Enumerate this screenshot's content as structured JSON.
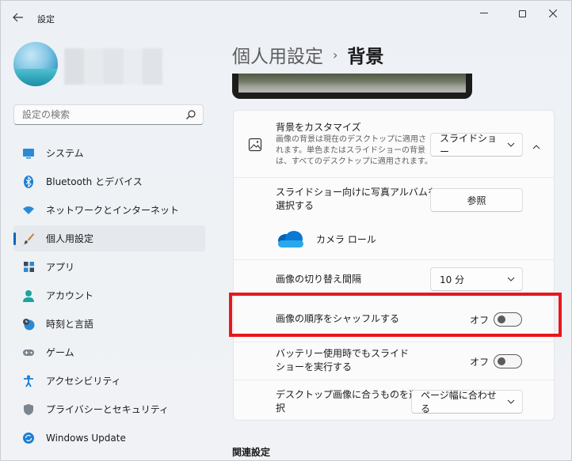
{
  "window": {
    "title": "設定",
    "controls": {
      "minimize": "—",
      "maximize": "",
      "close": "✕"
    }
  },
  "sidebar": {
    "search": {
      "placeholder": "設定の検索"
    },
    "items": [
      {
        "label": "システム",
        "icon": "monitor-icon",
        "active": false
      },
      {
        "label": "Bluetooth とデバイス",
        "icon": "bluetooth-icon",
        "active": false
      },
      {
        "label": "ネットワークとインターネット",
        "icon": "wifi-icon",
        "active": false
      },
      {
        "label": "個人用設定",
        "icon": "brush-icon",
        "active": true
      },
      {
        "label": "アプリ",
        "icon": "apps-icon",
        "active": false
      },
      {
        "label": "アカウント",
        "icon": "person-icon",
        "active": false
      },
      {
        "label": "時刻と言語",
        "icon": "clock-globe-icon",
        "active": false
      },
      {
        "label": "ゲーム",
        "icon": "gamepad-icon",
        "active": false
      },
      {
        "label": "アクセシビリティ",
        "icon": "accessibility-icon",
        "active": false
      },
      {
        "label": "プライバシーとセキュリティ",
        "icon": "shield-icon",
        "active": false
      },
      {
        "label": "Windows Update",
        "icon": "update-icon",
        "active": false
      }
    ]
  },
  "main": {
    "breadcrumb": {
      "parent": "個人用設定",
      "separator": "›",
      "current": "背景"
    },
    "customize": {
      "title": "背景をカスタマイズ",
      "description_line1": "画像の背景は現在のデスクトップに適用さ",
      "description_line2": "れます。単色またはスライドショーの背景",
      "description_line3": "は、すべてのデスクトップに適用されます。",
      "value": "スライドショー"
    },
    "album": {
      "title_line1": "スライドショー向けに写真アルバムを",
      "title_line2": "選択する",
      "button": "参照",
      "folder": "カメラ ロール"
    },
    "interval": {
      "title": "画像の切り替え間隔",
      "value": "10 分"
    },
    "shuffle": {
      "title": "画像の順序をシャッフルする",
      "state": "オフ",
      "on": false
    },
    "battery": {
      "title_line1": "バッテリー使用時でもスライド",
      "title_line2": "ショーを実行する",
      "state": "オフ",
      "on": false
    },
    "fit": {
      "title_line1": "デスクトップ画像に合うものを選",
      "title_line2": "択",
      "value": "ページ幅に合わせる"
    },
    "related_heading": "関連設定"
  },
  "colors": {
    "accent": "#0067c0",
    "highlight": "#e8171d",
    "onedrive": "#0a78d4"
  }
}
